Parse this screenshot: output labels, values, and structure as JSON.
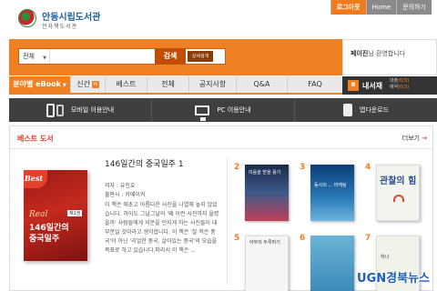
{
  "header": {
    "logo_name": "안동시립도서관",
    "logo_sub": "전자책도서관",
    "links": [
      {
        "label": "로그아웃"
      },
      {
        "label": "Home"
      },
      {
        "label": "문의하기"
      }
    ]
  },
  "search": {
    "category": "전체",
    "placeholder": "",
    "value": "",
    "button_label": "검색",
    "advanced_label": "상세검색"
  },
  "user": {
    "name": "페이진",
    "greeting_suffix": "님 환영합니다"
  },
  "nav": {
    "genre_label": "분야별 eBook",
    "items": [
      {
        "label": "신간",
        "badge": "N"
      },
      {
        "label": "베스트"
      },
      {
        "label": "전체"
      },
      {
        "label": "공지사항"
      },
      {
        "label": "Q&A"
      },
      {
        "label": "FAQ"
      }
    ]
  },
  "my_library": {
    "icon": "B",
    "title": "내서재",
    "loan_label": "대출",
    "loan_value": "(0/3)",
    "reserve_label": "예약",
    "reserve_value": "(0/3)"
  },
  "guide": [
    {
      "label": "모바일 이용안내",
      "icon": "mobile-phone-icon"
    },
    {
      "label": "PC 이용안내",
      "icon": "monitor-icon"
    },
    {
      "label": "앱다운로드",
      "icon": "app-icon"
    }
  ],
  "best": {
    "title": "베스트 도서",
    "more_label": "더보기",
    "featured": {
      "cover_badge": "Best",
      "cover_real": "Real",
      "cover_line1": "146일간의",
      "cover_line2": "중국일주",
      "cover_vol": "제1권",
      "title": "146일간의 중국일주 1",
      "author_label": "저자 : 유진호",
      "publisher_label": "출판사 : 카메이커",
      "description": "이 책은 애초고 아름다운 사진을 나열해 놓지 않았습니다. 하이도 그날그날의 '왜 이런 사진까지 올렸을까' 사람들에게 의문을 던지게 하는 사진들이 대부분일 것이라고 생각합니다. 이 책은 '잘 적은 중국'이 아닌 '리얼한 중국, 살아있는 중국'의 모습을 목표로 하고 있습니다.따라서 이 책은 ..."
    },
    "ranks": [
      "2",
      "3",
      "4",
      "5",
      "6",
      "7"
    ],
    "cover_texts": {
      "b2": "미움을 받을 용기",
      "b3": "동사의 ... 마케팅",
      "b4": "관찰의 힘",
      "b5": "아무의 두루마기",
      "b6": "",
      "b7": "하나"
    }
  },
  "watermark": "UGN경북뉴스"
}
